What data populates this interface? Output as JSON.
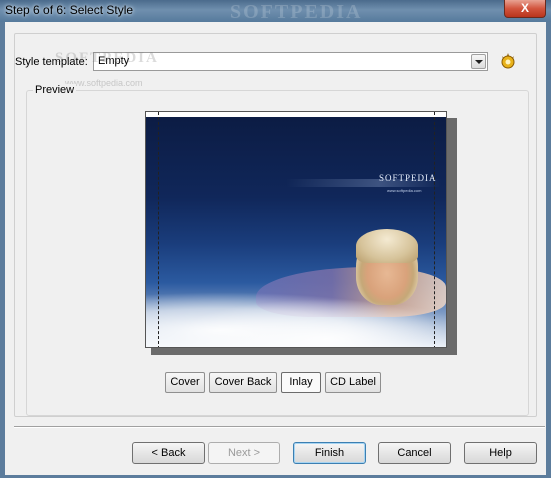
{
  "window": {
    "title": "Step 6 of 6: Select Style",
    "watermark": "SOFTPEDIA",
    "close_label": "X"
  },
  "style_template": {
    "label": "Style template:",
    "value": "Empty",
    "watermark": "SOFTPEDIA",
    "watermark_url": "www.softpedia.com"
  },
  "preview": {
    "legend": "Preview",
    "cover_logo": "SOFTPEDIA",
    "cover_url": "www.softpedia.com"
  },
  "tabs": [
    {
      "label": "Cover"
    },
    {
      "label": "Cover Back"
    },
    {
      "label": "Inlay"
    },
    {
      "label": "CD Label"
    }
  ],
  "active_tab": "Inlay",
  "footer": {
    "back": "< Back",
    "next": "Next >",
    "finish": "Finish",
    "cancel": "Cancel",
    "help": "Help"
  },
  "colors": {
    "titlebar": "#567a9c",
    "close": "#c9432b",
    "default_button_border": "#3c7fb1"
  }
}
